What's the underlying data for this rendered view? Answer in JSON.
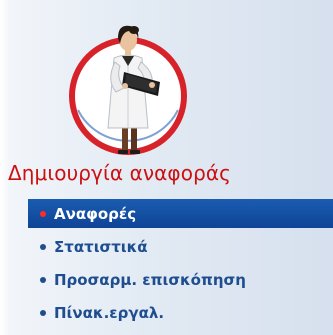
{
  "sidebar": {
    "title": "Δημιουργία αναφοράς",
    "illustration_icon": "doctor-with-clipboard-icon",
    "items": [
      {
        "label": "Αναφορές",
        "active": true
      },
      {
        "label": "Στατιστικά",
        "active": false
      },
      {
        "label": "Προσαρμ. επισκόπηση",
        "active": false
      },
      {
        "label": "Πίνακ.εργαλ.",
        "active": false
      }
    ]
  },
  "colors": {
    "title": "#cc1010",
    "menu_text": "#1f4e90",
    "active_bg": "#1450a3",
    "active_bullet": "#ff2a2a",
    "circle_ring": "#d8222a"
  }
}
